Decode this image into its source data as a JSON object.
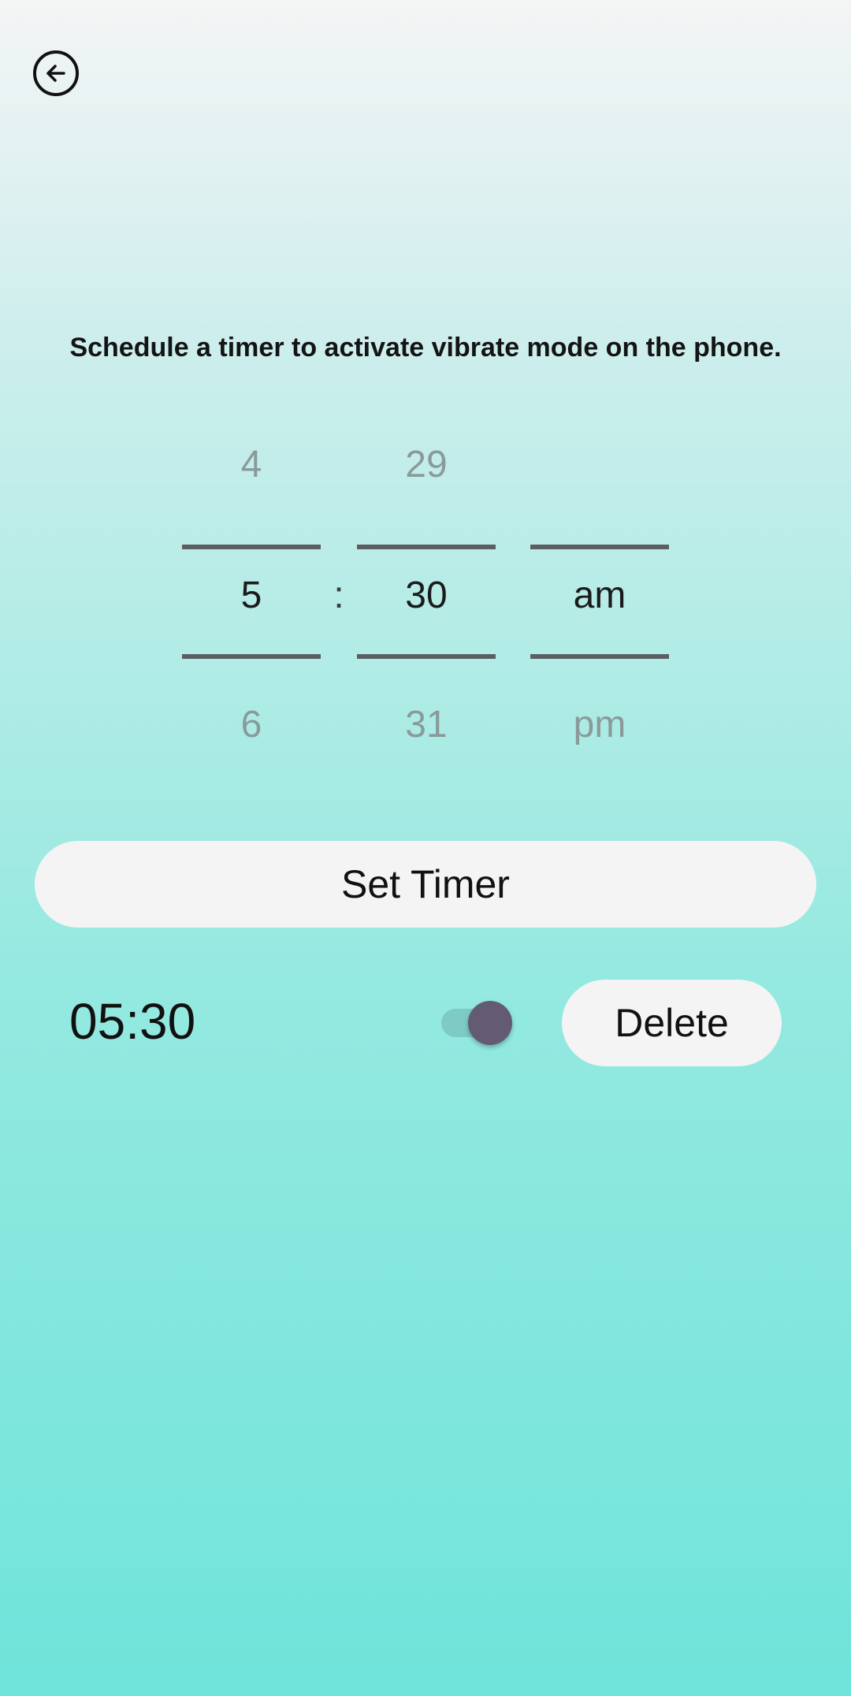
{
  "header": {
    "back_icon": "arrow-left-circle-icon"
  },
  "instruction": "Schedule a timer to activate vibrate mode on the phone.",
  "picker": {
    "hours": {
      "prev": "4",
      "current": "5",
      "next": "6"
    },
    "separator": ":",
    "minutes": {
      "prev": "29",
      "current": "30",
      "next": "31"
    },
    "ampm": {
      "prev": "",
      "current": "am",
      "next": "pm"
    }
  },
  "set_timer_label": "Set Timer",
  "scheduled_timer": {
    "time": "05:30",
    "enabled": true,
    "delete_label": "Delete"
  },
  "colors": {
    "toggle_thumb": "#625b73",
    "button_bg": "#f4f4f4",
    "gradient_bottom": "#6fe4da"
  }
}
